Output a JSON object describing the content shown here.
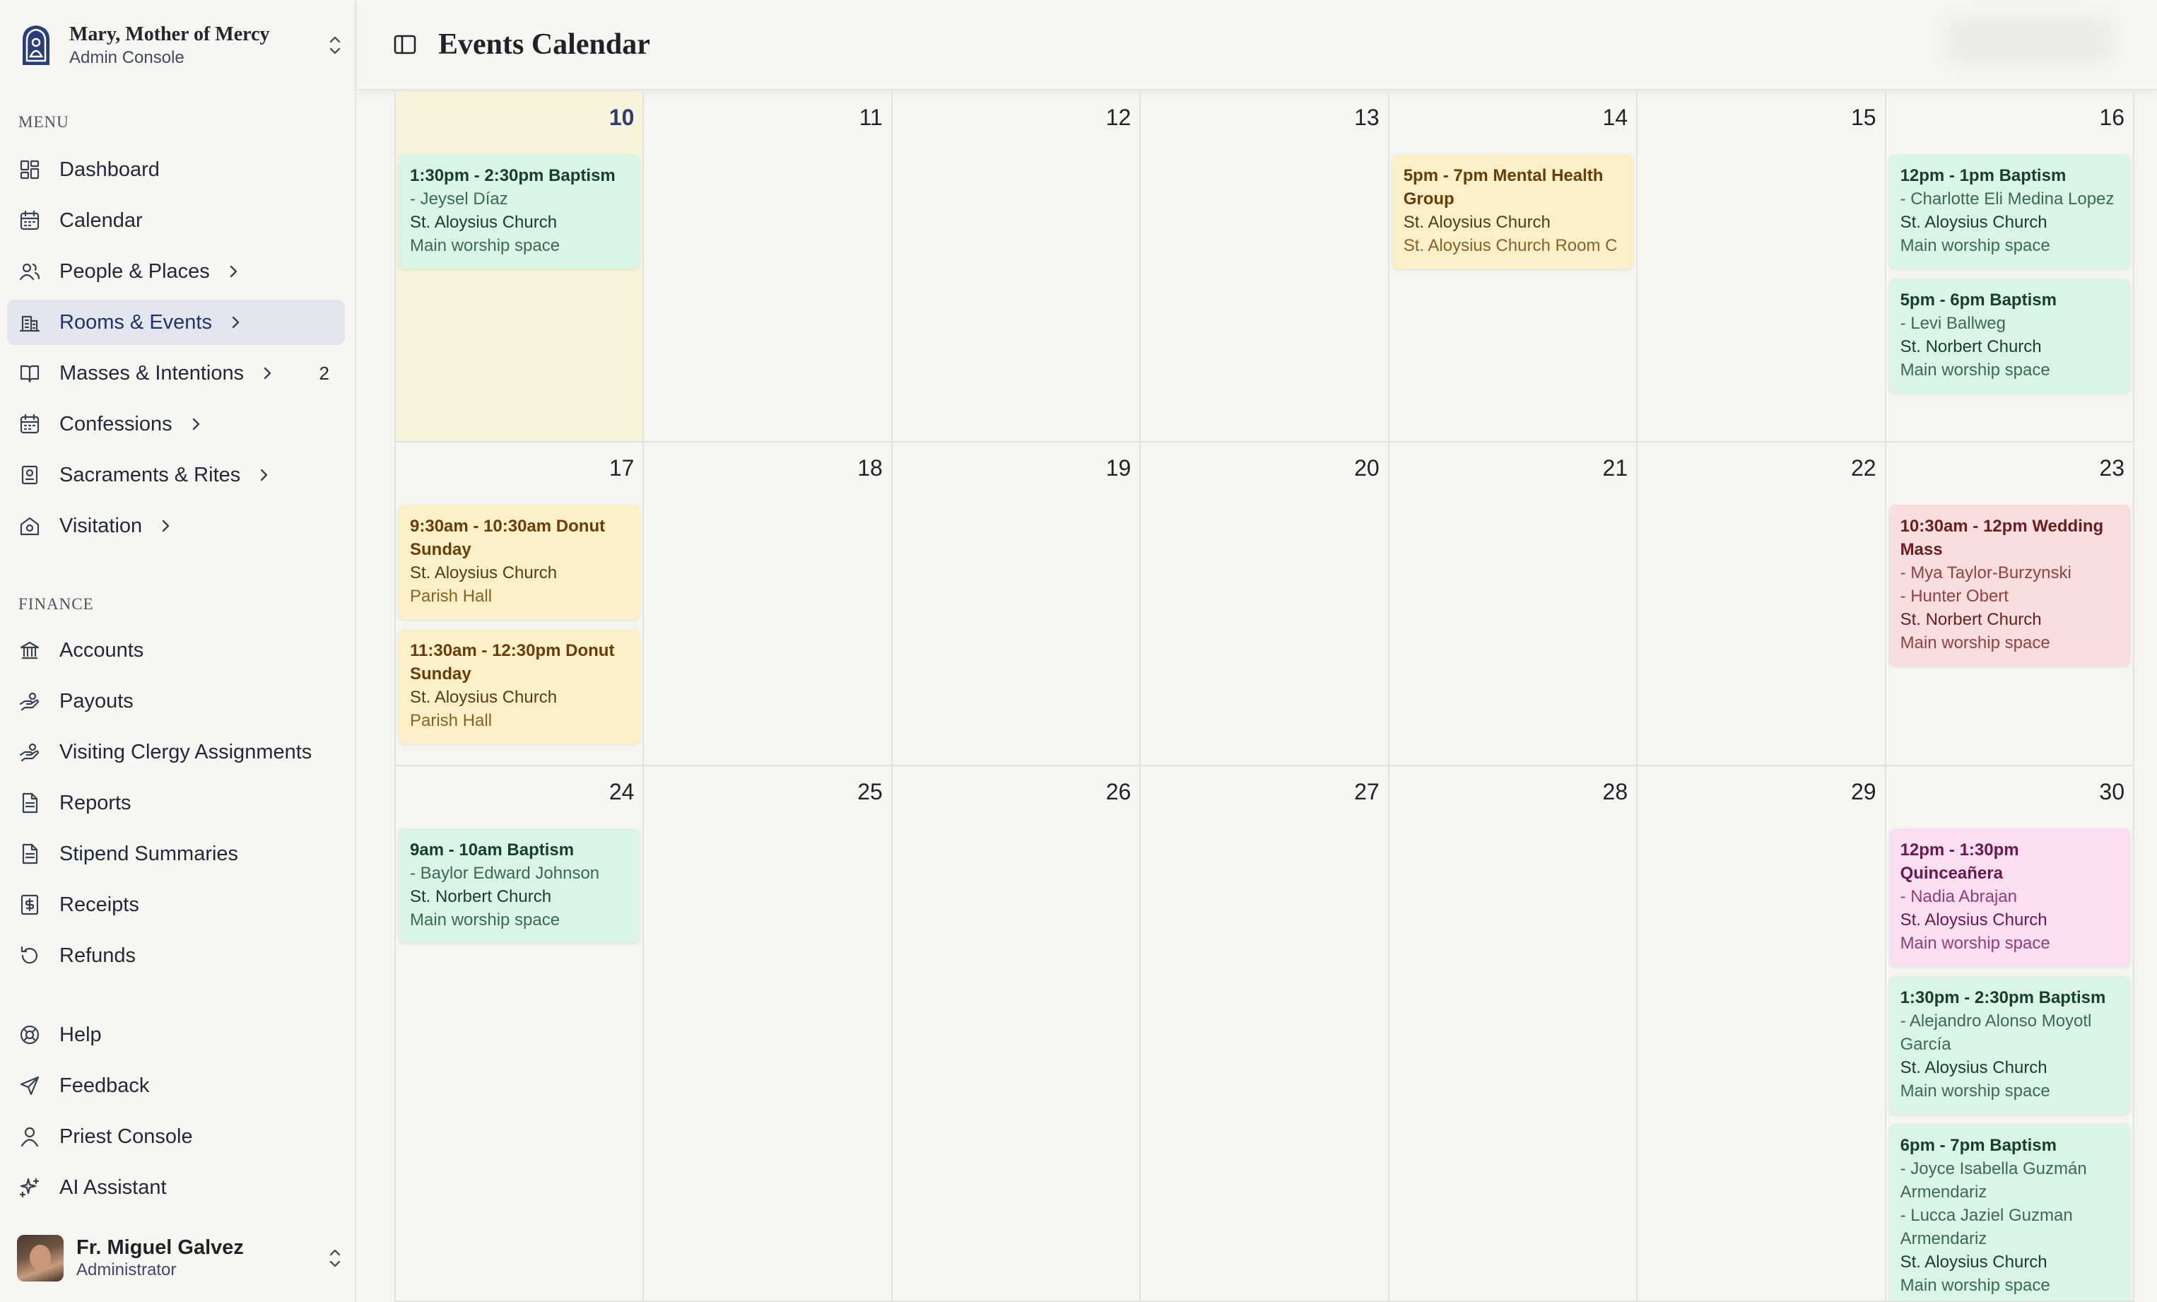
{
  "org": {
    "name": "Mary, Mother of Mercy",
    "subtitle": "Admin Console"
  },
  "menu_label": "MENU",
  "finance_label": "FINANCE",
  "menu": [
    {
      "label": "Dashboard",
      "icon": "dashboard-icon"
    },
    {
      "label": "Calendar",
      "icon": "calendar-icon"
    },
    {
      "label": "People & Places",
      "icon": "people-icon",
      "chevron": true
    },
    {
      "label": "Rooms & Events",
      "icon": "building-icon",
      "chevron": true,
      "active": true
    },
    {
      "label": "Masses & Intentions",
      "icon": "book-icon",
      "chevron": true,
      "badge": "2"
    },
    {
      "label": "Confessions",
      "icon": "calendar-icon",
      "chevron": true
    },
    {
      "label": "Sacraments & Rites",
      "icon": "sacrament-icon",
      "chevron": true
    },
    {
      "label": "Visitation",
      "icon": "home-icon",
      "chevron": true
    }
  ],
  "finance": [
    {
      "label": "Accounts",
      "icon": "bank-icon"
    },
    {
      "label": "Payouts",
      "icon": "hand-coins-icon"
    },
    {
      "label": "Visiting Clergy Assignments",
      "icon": "hand-coins-icon"
    },
    {
      "label": "Reports",
      "icon": "document-icon"
    },
    {
      "label": "Stipend Summaries",
      "icon": "document-icon"
    },
    {
      "label": "Receipts",
      "icon": "receipt-icon"
    },
    {
      "label": "Refunds",
      "icon": "refresh-icon"
    }
  ],
  "footer_nav": [
    {
      "label": "Help",
      "icon": "lifebuoy-icon"
    },
    {
      "label": "Feedback",
      "icon": "send-icon"
    },
    {
      "label": "Priest Console",
      "icon": "user-icon"
    },
    {
      "label": "AI Assistant",
      "icon": "sparkles-icon"
    }
  ],
  "user": {
    "name": "Fr. Miguel Galvez",
    "role": "Administrator"
  },
  "header": {
    "title": "Events Calendar"
  },
  "colors": {
    "green": "#daf5e6",
    "yellow": "#fcf0c8",
    "red": "#f8dede",
    "pink": "#f9dff0",
    "today": "#faf3dc",
    "active_nav": "#e3e6ef"
  },
  "calendar": {
    "weeks": [
      [
        {
          "day": "10",
          "today": true,
          "events": [
            {
              "title": "1:30pm - 2:30pm Baptism",
              "people": [
                "- Jeysel Díaz"
              ],
              "church": "St. Aloysius Church",
              "room": "Main worship space",
              "color": "green"
            }
          ]
        },
        {
          "day": "11",
          "events": []
        },
        {
          "day": "12",
          "events": []
        },
        {
          "day": "13",
          "events": []
        },
        {
          "day": "14",
          "events": [
            {
              "title": "5pm - 7pm Mental Health Group",
              "people": [],
              "church": "St. Aloysius Church",
              "room": "St. Aloysius Church Room C",
              "color": "yellow"
            }
          ]
        },
        {
          "day": "15",
          "events": []
        },
        {
          "day": "16",
          "events": [
            {
              "title": "12pm - 1pm Baptism",
              "people": [
                "- Charlotte Eli Medina Lopez"
              ],
              "church": "St. Aloysius Church",
              "room": "Main worship space",
              "color": "green"
            },
            {
              "title": "5pm - 6pm Baptism",
              "people": [
                "- Levi Ballweg"
              ],
              "church": "St. Norbert Church",
              "room": "Main worship space",
              "color": "green"
            }
          ]
        }
      ],
      [
        {
          "day": "17",
          "events": [
            {
              "title": "9:30am - 10:30am Donut Sunday",
              "people": [],
              "church": "St. Aloysius Church",
              "room": "Parish Hall",
              "color": "yellow"
            },
            {
              "title": "11:30am - 12:30pm Donut Sunday",
              "people": [],
              "church": "St. Aloysius Church",
              "room": "Parish Hall",
              "color": "yellow"
            }
          ]
        },
        {
          "day": "18",
          "events": []
        },
        {
          "day": "19",
          "events": []
        },
        {
          "day": "20",
          "events": []
        },
        {
          "day": "21",
          "events": []
        },
        {
          "day": "22",
          "events": []
        },
        {
          "day": "23",
          "events": [
            {
              "title": "10:30am - 12pm Wedding Mass",
              "people": [
                "- Mya Taylor-Burzynski",
                "- Hunter Obert"
              ],
              "church": "St. Norbert Church",
              "room": "Main worship space",
              "color": "red"
            }
          ]
        }
      ],
      [
        {
          "day": "24",
          "events": [
            {
              "title": "9am - 10am Baptism",
              "people": [
                "- Baylor Edward Johnson"
              ],
              "church": "St. Norbert Church",
              "room": "Main worship space",
              "color": "green"
            }
          ]
        },
        {
          "day": "25",
          "events": []
        },
        {
          "day": "26",
          "events": []
        },
        {
          "day": "27",
          "events": []
        },
        {
          "day": "28",
          "events": []
        },
        {
          "day": "29",
          "events": []
        },
        {
          "day": "30",
          "events": [
            {
              "title": "12pm - 1:30pm Quinceañera",
              "people": [
                "- Nadia Abrajan"
              ],
              "church": "St. Aloysius Church",
              "room": "Main worship space",
              "color": "pink"
            },
            {
              "title": "1:30pm - 2:30pm Baptism",
              "people": [
                "- Alejandro Alonso Moyotl García"
              ],
              "church": "St. Aloysius Church",
              "room": "Main worship space",
              "color": "green"
            },
            {
              "title": "6pm - 7pm Baptism",
              "people": [
                "- Joyce Isabella Guzmán Armendariz",
                "- Lucca Jaziel Guzman Armendariz"
              ],
              "church": "St. Aloysius Church",
              "room": "Main worship space",
              "color": "green"
            }
          ]
        }
      ]
    ]
  }
}
